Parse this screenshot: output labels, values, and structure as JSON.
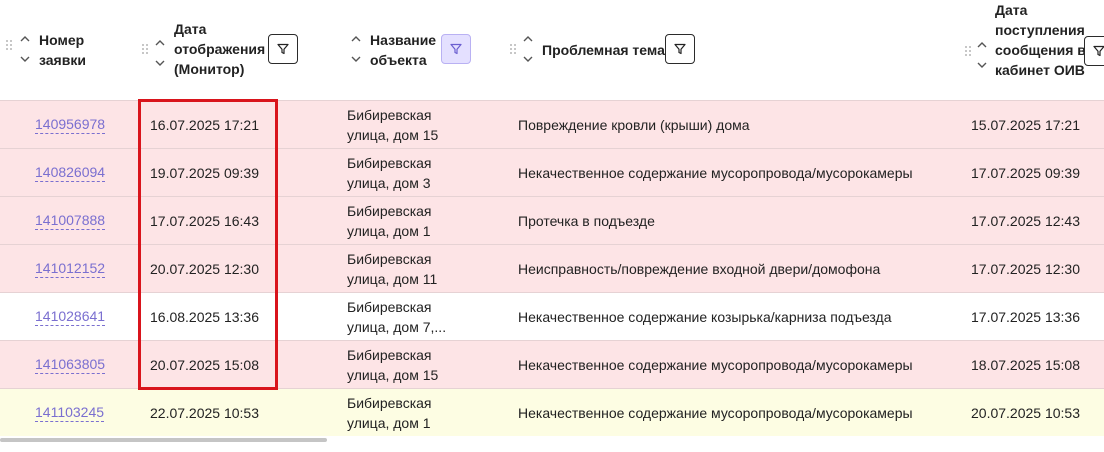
{
  "table": {
    "columns": [
      {
        "id": "number",
        "label": "Номер заявки",
        "filter_active": false
      },
      {
        "id": "monitor_date",
        "label": "Дата отображения (Монитор)",
        "filter_active": false
      },
      {
        "id": "object",
        "label": "Название объекта",
        "filter_active": true
      },
      {
        "id": "topic",
        "label": "Проблемная тема",
        "filter_active": false
      },
      {
        "id": "received_date",
        "label": "Дата поступления сообщения в кабинет ОИВ",
        "filter_active": false
      }
    ],
    "rows": [
      {
        "number": "140956978",
        "monitor_date": "16.07.2025 17:21",
        "object_line1": "Бибиревская",
        "object_line2": "улица, дом 15",
        "topic": "Повреждение кровли (крыши) дома",
        "received_date": "15.07.2025 17:21",
        "status": "overdue"
      },
      {
        "number": "140826094",
        "monitor_date": "19.07.2025 09:39",
        "object_line1": "Бибиревская",
        "object_line2": "улица, дом 3",
        "topic": "Некачественное содержание мусоропровода/мусорокамеры",
        "received_date": "17.07.2025 09:39",
        "status": "overdue"
      },
      {
        "number": "141007888",
        "monitor_date": "17.07.2025 16:43",
        "object_line1": "Бибиревская",
        "object_line2": "улица, дом 1",
        "topic": "Протечка в подъезде",
        "received_date": "17.07.2025 12:43",
        "status": "overdue"
      },
      {
        "number": "141012152",
        "monitor_date": "20.07.2025 12:30",
        "object_line1": "Бибиревская",
        "object_line2": "улица, дом 11",
        "topic": "Неисправность/повреждение входной двери/домофона",
        "received_date": "17.07.2025 12:30",
        "status": "overdue"
      },
      {
        "number": "141028641",
        "monitor_date": "16.08.2025 13:36",
        "object_line1": "Бибиревская",
        "object_line2": "улица, дом 7,...",
        "topic": "Некачественное содержание козырька/карниза подъезда",
        "received_date": "17.07.2025 13:36",
        "status": "normal"
      },
      {
        "number": "141063805",
        "monitor_date": "20.07.2025 15:08",
        "object_line1": "Бибиревская",
        "object_line2": "улица, дом 15",
        "topic": "Некачественное содержание мусоропровода/мусорокамеры",
        "received_date": "18.07.2025 15:08",
        "status": "overdue"
      },
      {
        "number": "141103245",
        "monitor_date": "22.07.2025 10:53",
        "object_line1": "Бибиревская",
        "object_line2": "улица, дом 1",
        "topic": "Некачественное содержание мусоропровода/мусорокамеры",
        "received_date": "20.07.2025 10:53",
        "status": "warning"
      }
    ]
  },
  "colors": {
    "overdue": "#fde4e6",
    "normal": "#ffffff",
    "warning": "#fdfde3",
    "link": "#7a6fd0",
    "highlight": "#d9141c",
    "filter_active_bg": "#e4e0ff"
  },
  "icons": {
    "grip": "drag-handle-icon",
    "sort": "sort-arrows-icon",
    "filter": "filter-icon"
  }
}
